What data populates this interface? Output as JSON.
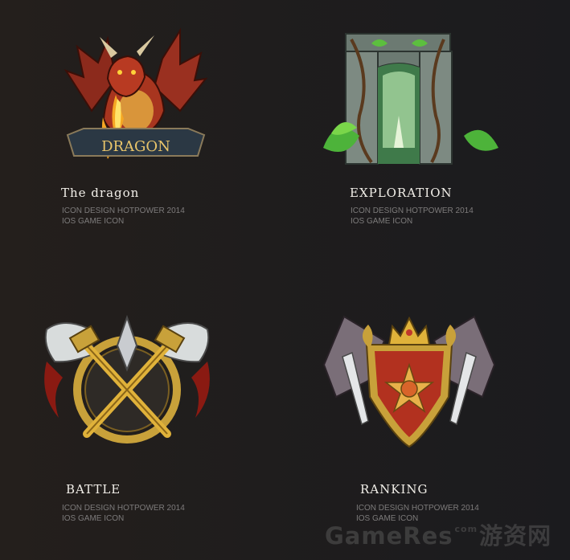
{
  "cards": [
    {
      "title": "The dragon",
      "line1": "ICON DESIGN HOTPOWER 2014",
      "line2": "IOS GAME ICON",
      "banner": "DRAGON"
    },
    {
      "title": "EXPLORATION",
      "line1": "ICON DESIGN HOTPOWER 2014",
      "line2": "IOS GAME ICON"
    },
    {
      "title": "BATTLE",
      "line1": "ICON DESIGN HOTPOWER 2014",
      "line2": "IOS GAME ICON"
    },
    {
      "title": "RANKING",
      "line1": "ICON DESIGN HOTPOWER 2014",
      "line2": "IOS GAME ICON"
    }
  ],
  "watermark": {
    "brand": "GameRes",
    "suffix": "com",
    "cn": "游资网"
  },
  "colors": {
    "background": "#201e1d",
    "title": "#f2efe9",
    "subtitle": "#7d7b7b"
  }
}
